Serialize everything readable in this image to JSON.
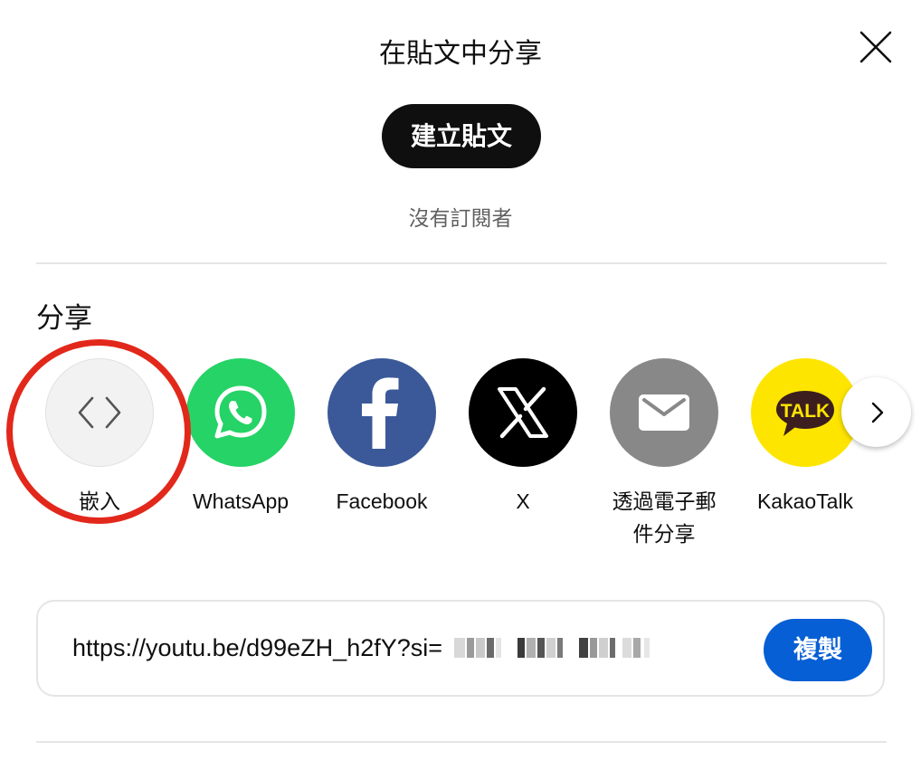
{
  "dialog": {
    "title": "在貼文中分享",
    "create_post_label": "建立貼文",
    "subscribers_text": "沒有訂閱者"
  },
  "share": {
    "heading": "分享",
    "targets": [
      {
        "label": "嵌入",
        "icon": "embed-code-icon",
        "color": "#f2f2f2"
      },
      {
        "label": "WhatsApp",
        "icon": "whatsapp-icon",
        "color": "#25d366"
      },
      {
        "label": "Facebook",
        "icon": "facebook-icon",
        "color": "#3b5998"
      },
      {
        "label": "X",
        "icon": "x-logo-icon",
        "color": "#000000"
      },
      {
        "label_line1": "透過電子郵",
        "label_line2": "件分享",
        "icon": "email-icon",
        "color": "#888888"
      },
      {
        "label": "KakaoTalk",
        "icon": "kakaotalk-icon",
        "color": "#fee500"
      }
    ],
    "next_icon": "chevron-right-icon"
  },
  "link": {
    "url": "https://youtu.be/d99eZH_h2fY?si=",
    "copy_label": "複製",
    "copy_color": "#065fd4"
  },
  "annotation": {
    "highlight_color": "#e2281b",
    "highlights": "embed"
  }
}
